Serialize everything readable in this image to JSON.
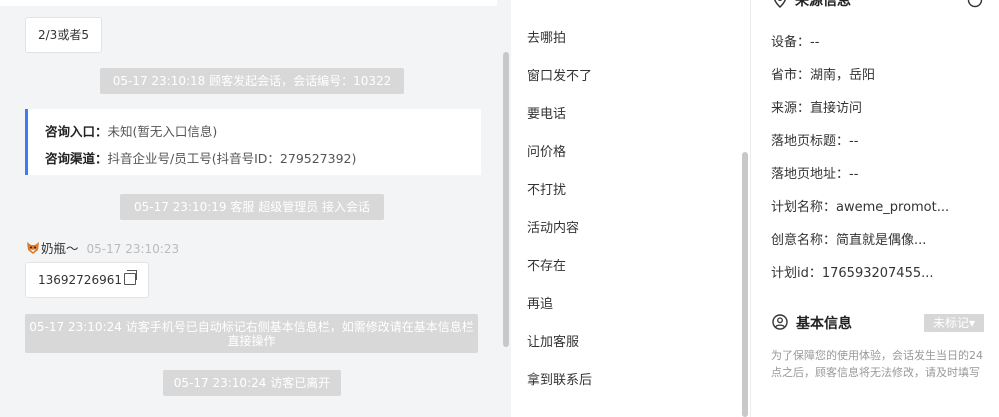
{
  "chat": {
    "option_bubble": "2/3或者5",
    "sys_msg_1": "05-17 23:10:18 顾客发起会话，会话编号：10322",
    "consult_entry_label": "咨询入口：",
    "consult_entry_value": "未知(暂无入口信息)",
    "consult_channel_label": "咨询渠道：",
    "consult_channel_value": "抖音企业号/员工号(抖音号ID：279527392)",
    "sys_msg_2": "05-17 23:10:19 客服 超级管理员 接入会话",
    "author_name": "奶瓶～",
    "author_time": "05-17 23:10:23",
    "phone_bubble": "13692726961",
    "sys_msg_3": "05-17 23:10:24 访客手机号已自动标记右侧基本信息栏，如需修改请在基本信息栏直接操作",
    "sys_msg_4": "05-17 23:10:24 访客已离开"
  },
  "quick_replies": [
    "去哪拍",
    "窗口发不了",
    "要电话",
    "问价格",
    "不打扰",
    "活动内容",
    "不存在",
    "再追",
    "让加客服",
    "拿到联系后"
  ],
  "source_info": {
    "title": "来源信息",
    "device": "设备：--",
    "region": "省市：湖南，岳阳",
    "source": "来源：直接访问",
    "landing_title": "落地页标题：--",
    "landing_url": "落地页地址：--",
    "plan_name": "计划名称：aweme_promot...",
    "creative_name": "创意名称：简直就是偶像...",
    "plan_id": "计划id：176593207455..."
  },
  "basic_info": {
    "title": "基本信息",
    "tag": "未标记▾",
    "note": "为了保障您的使用体验，会话发生当日的24点之后，顾客信息将无法修改，请及时填写"
  }
}
